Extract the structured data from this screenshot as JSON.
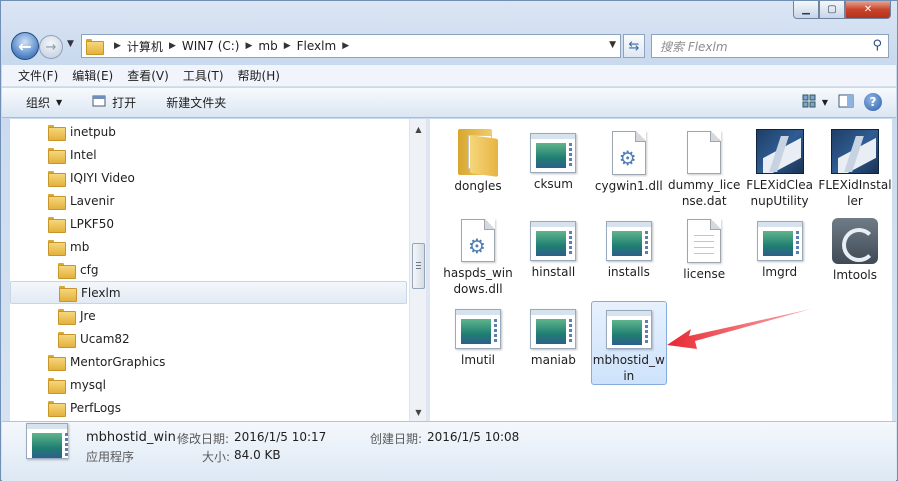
{
  "window": {
    "minimize_glyph": "▁",
    "maximize_glyph": "▢",
    "close_glyph": "✕"
  },
  "address": {
    "crumbs": [
      "计算机",
      "WIN7 (C:)",
      "mb",
      "Flexlm"
    ],
    "search_placeholder": "搜索 Flexlm"
  },
  "menu": [
    "文件(F)",
    "编辑(E)",
    "查看(V)",
    "工具(T)",
    "帮助(H)"
  ],
  "toolbar": {
    "organize": "组织",
    "open": "打开",
    "new_folder": "新建文件夹",
    "help": "?"
  },
  "tree": [
    {
      "label": "inetpub",
      "indent": 0
    },
    {
      "label": "Intel",
      "indent": 0
    },
    {
      "label": "IQIYI Video",
      "indent": 0
    },
    {
      "label": "Lavenir",
      "indent": 0
    },
    {
      "label": "LPKF50",
      "indent": 0
    },
    {
      "label": "mb",
      "indent": 0
    },
    {
      "label": "cfg",
      "indent": 1
    },
    {
      "label": "Flexlm",
      "indent": 1,
      "selected": true
    },
    {
      "label": "Jre",
      "indent": 1
    },
    {
      "label": "Ucam82",
      "indent": 1
    },
    {
      "label": "MentorGraphics",
      "indent": 0
    },
    {
      "label": "mysql",
      "indent": 0
    },
    {
      "label": "PerfLogs",
      "indent": 0
    }
  ],
  "files": [
    {
      "label": "dongles",
      "icon": "folder-icon"
    },
    {
      "label": "cksum",
      "icon": "app-icon"
    },
    {
      "label": "cygwin1.dll",
      "icon": "dll-icon"
    },
    {
      "label": "dummy_license.dat",
      "icon": "file-icon"
    },
    {
      "label": "FLEXidCleanupUtility",
      "icon": "flexid-icon"
    },
    {
      "label": "FLEXidInstaller",
      "icon": "flexid-icon"
    },
    {
      "label": "haspds_windows.dll",
      "icon": "dll-icon"
    },
    {
      "label": "hinstall",
      "icon": "app-icon"
    },
    {
      "label": "installs",
      "icon": "app-icon"
    },
    {
      "label": "license",
      "icon": "text-file-icon"
    },
    {
      "label": "lmgrd",
      "icon": "app-icon"
    },
    {
      "label": "lmtools",
      "icon": "lmtools-icon"
    },
    {
      "label": "lmutil",
      "icon": "app-icon"
    },
    {
      "label": "maniab",
      "icon": "app-icon"
    },
    {
      "label": "mbhostid_win",
      "icon": "app-icon",
      "selected": true
    }
  ],
  "details": {
    "name": "mbhostid_win",
    "type": "应用程序",
    "modified_label": "修改日期:",
    "modified_value": "2016/1/5 10:17",
    "created_label": "创建日期:",
    "created_value": "2016/1/5 10:08",
    "size_label": "大小:",
    "size_value": "84.0 KB"
  },
  "colors": {
    "annotation_arrow": "#e8262e",
    "selection": "#cde2fb"
  }
}
